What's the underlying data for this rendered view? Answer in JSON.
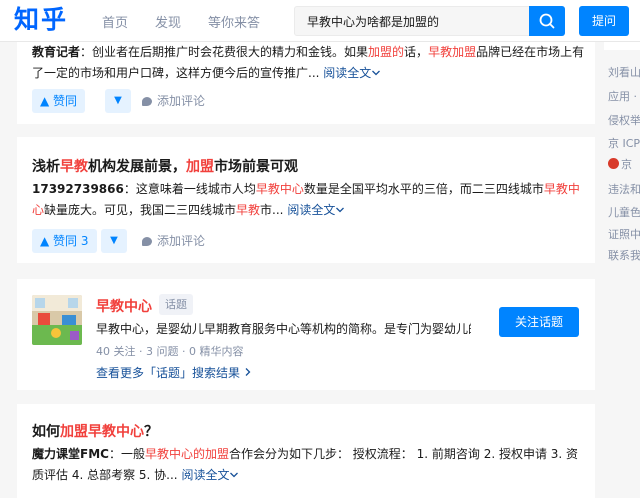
{
  "header": {
    "logo": "知乎",
    "nav": [
      "首页",
      "发现",
      "等你来答"
    ],
    "search_value": "早教中心为啥都是加盟的",
    "ask_label": "提问"
  },
  "sidebar": {
    "lines": [
      "刘看山",
      "应用 ·",
      "侵权举",
      "京 ICP",
      "京",
      "违法和",
      "儿童色",
      "证照中",
      "联系我"
    ]
  },
  "answer1": {
    "author": "教育记者",
    "segments": [
      "：创业者在后期推广时会花费很大的精力和金钱。如果",
      "加盟的",
      "话，",
      "早教加盟",
      "品牌已经在市场上有了一定的市场和用户口碑，这样方便今后的宣传推广..."
    ],
    "read_more": "阅读全文",
    "vote_label": "▲ 赞同",
    "comment_label": "添加评论"
  },
  "answer2": {
    "title_segments": [
      "浅析",
      "早教",
      "机构发展前景，",
      "加盟",
      "市场前景可观"
    ],
    "author": "17392739866",
    "segments": [
      "：这意味着一线城市人均",
      "早教中心",
      "数量是全国平均水平的三倍，而二三四线城市",
      "早教中心",
      "缺量庞大。可见，我国二三四线城市",
      "早教",
      "市..."
    ],
    "read_more": "阅读全文",
    "vote_label": "▲ 赞同 3",
    "comment_label": "添加评论"
  },
  "topic": {
    "name": "早教中心",
    "tag": "话题",
    "description": "早教中心，是婴幼儿早期教育服务中心等机构的简称。是专门为婴幼儿的",
    "stats": "40 关注 · 3 问题 · 0 精华内容",
    "more": "查看更多「话题」搜索结果",
    "follow_label": "关注话题"
  },
  "answer3": {
    "title_segments": [
      "如何",
      "加盟早教中心",
      "？"
    ],
    "author": "魔力课堂FMC",
    "segments": [
      "：一般",
      "早教中心的加盟",
      "合作会分为如下几步： 授权流程： 1. 前期咨询 2. 授权申请 3. 资质评估 4. 总部考察 5. 协..."
    ],
    "read_more": "阅读全文"
  },
  "colors": {
    "brand": "#0084ff",
    "highlight": "#f1403c",
    "link": "#175199",
    "muted": "#8590a6"
  },
  "icons": [
    "search-icon",
    "chevron-down-icon",
    "comment-icon",
    "police-badge-icon"
  ]
}
